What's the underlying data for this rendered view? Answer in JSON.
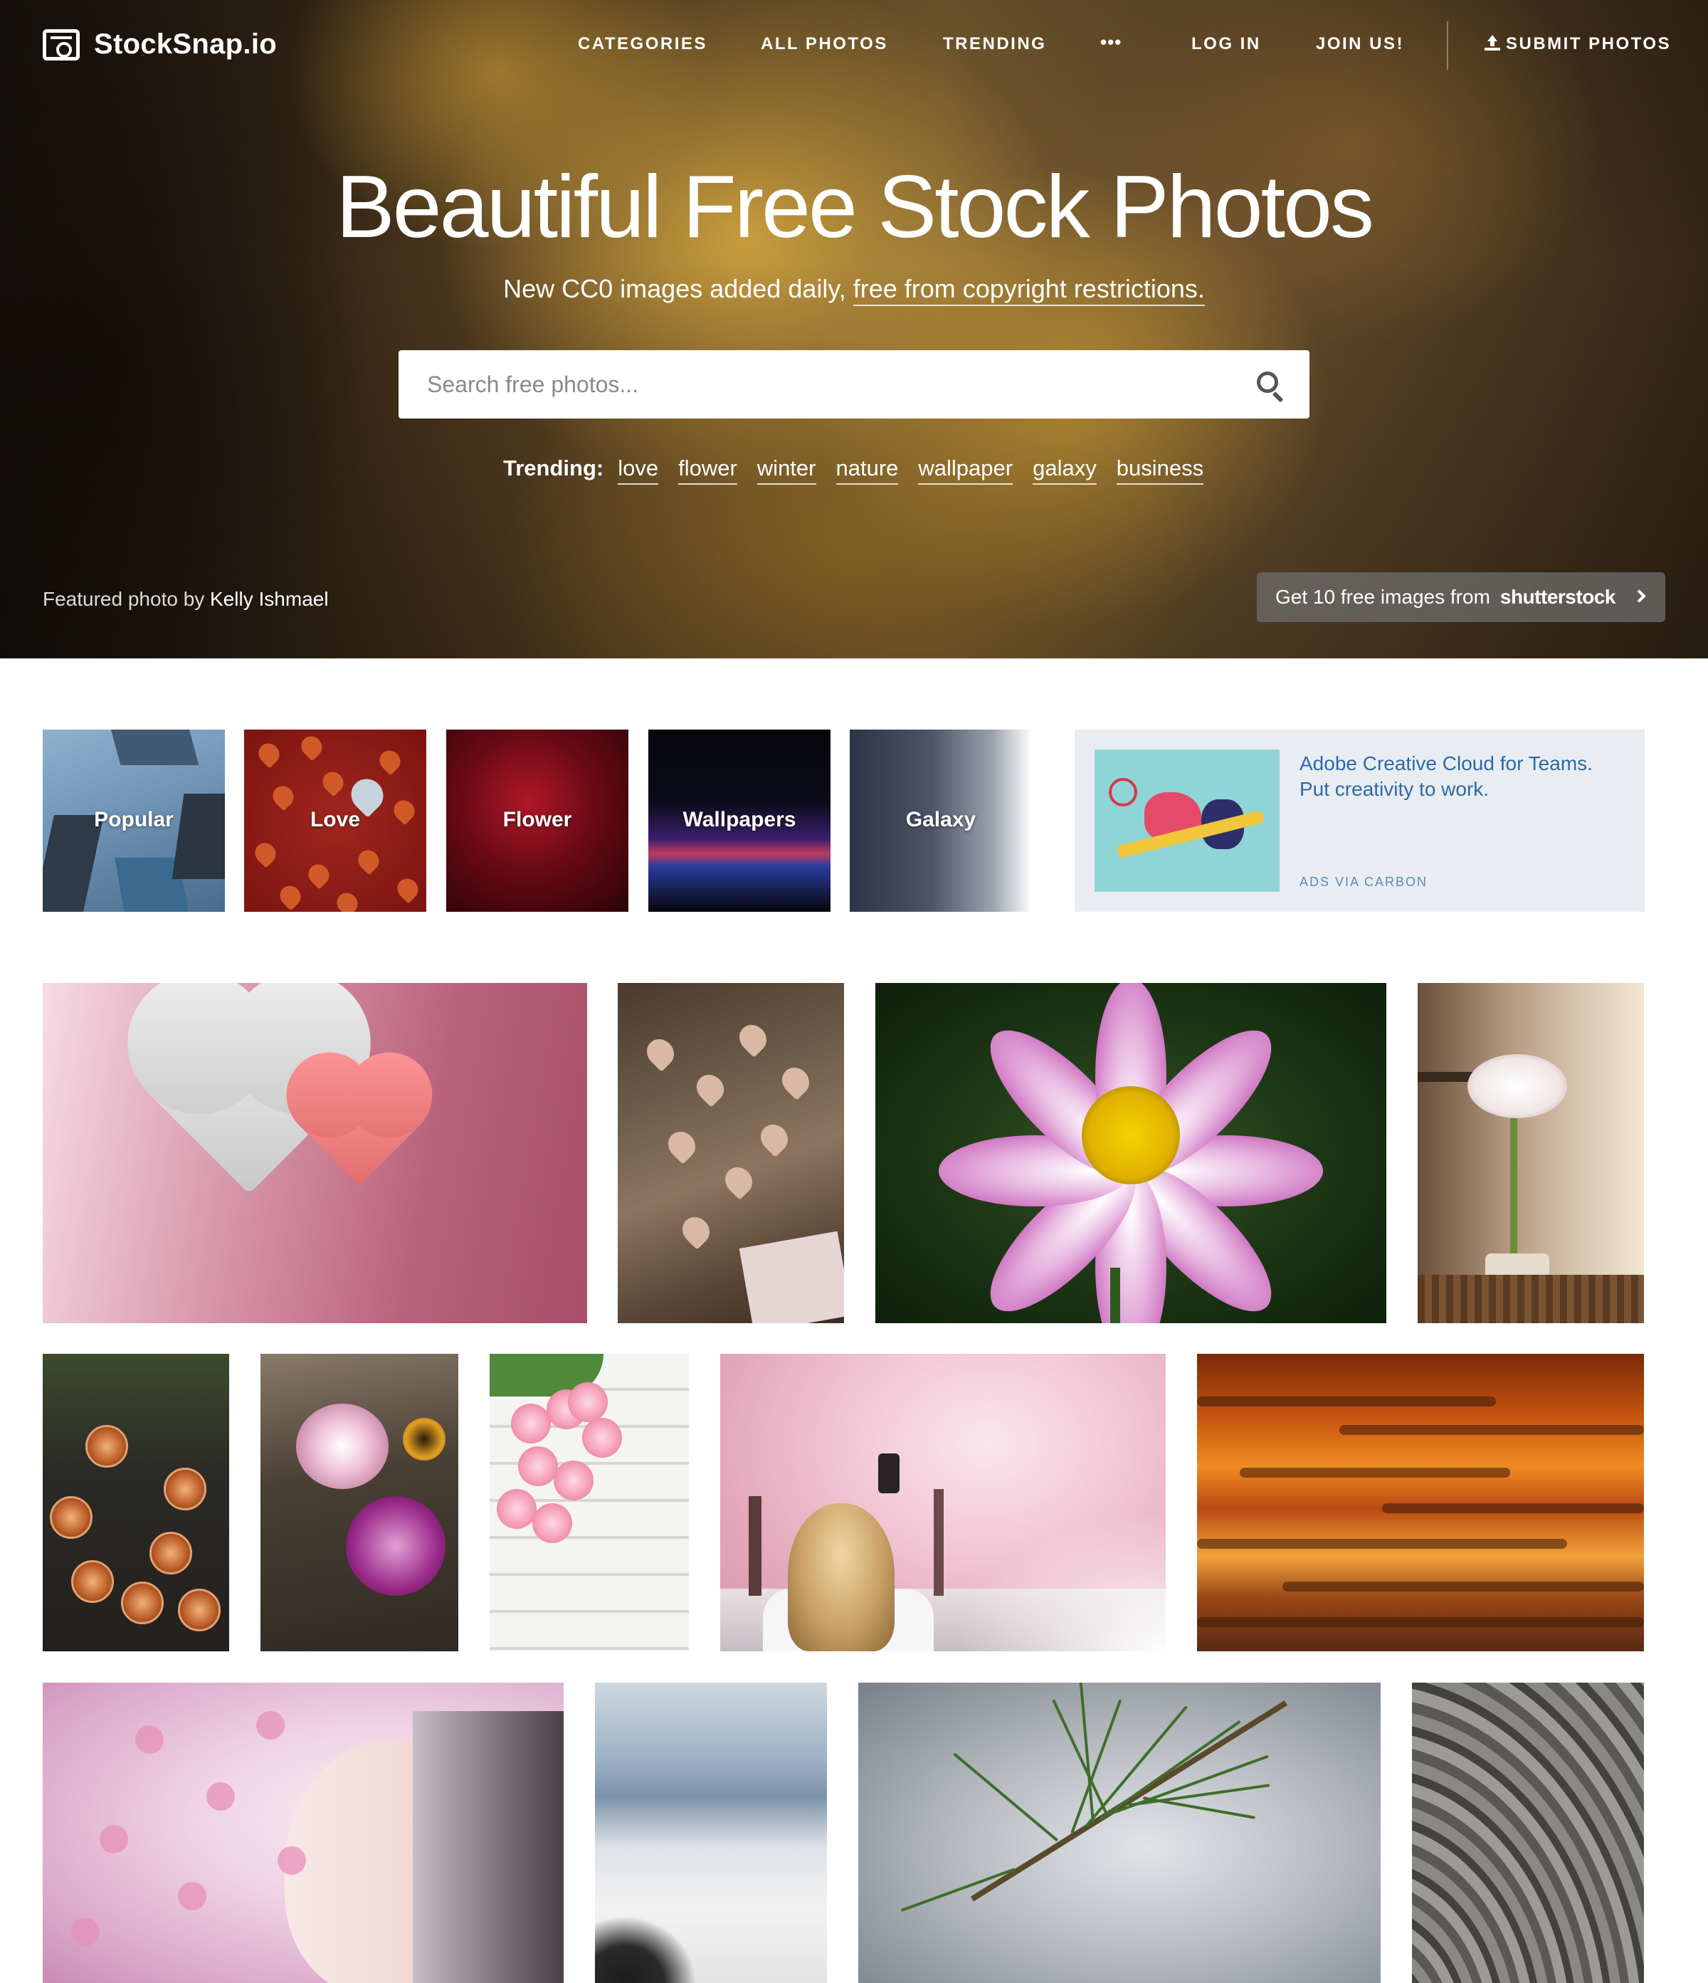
{
  "nav": {
    "logo": "StockSnap.io",
    "items": [
      "CATEGORIES",
      "ALL PHOTOS",
      "TRENDING",
      "•••",
      "LOG IN",
      "JOIN US!"
    ],
    "submit": "SUBMIT PHOTOS"
  },
  "hero": {
    "title": "Beautiful Free Stock Photos",
    "subtitle_prefix": "New CC0 images added daily, ",
    "subtitle_link": "free from copyright restrictions.",
    "search_placeholder": "Search free photos...",
    "trending_label": "Trending:",
    "trending_terms": [
      "love",
      "flower",
      "winter",
      "nature",
      "wallpaper",
      "galaxy",
      "business"
    ],
    "featured_prefix": "Featured photo by ",
    "featured_name": "Kelly Ishmael",
    "shutter_text": "Get 10 free images from",
    "shutter_brand": "shutterstock"
  },
  "categories": [
    "Popular",
    "Love",
    "Flower",
    "Wallpapers",
    "Galaxy"
  ],
  "ad": {
    "text": "Adobe Creative Cloud for Teams. Put creativity to work.",
    "via": "ADS VIA CARBON"
  },
  "colors": {
    "ad_link": "#2c6aa8",
    "ad_background": "#e9edf2"
  }
}
